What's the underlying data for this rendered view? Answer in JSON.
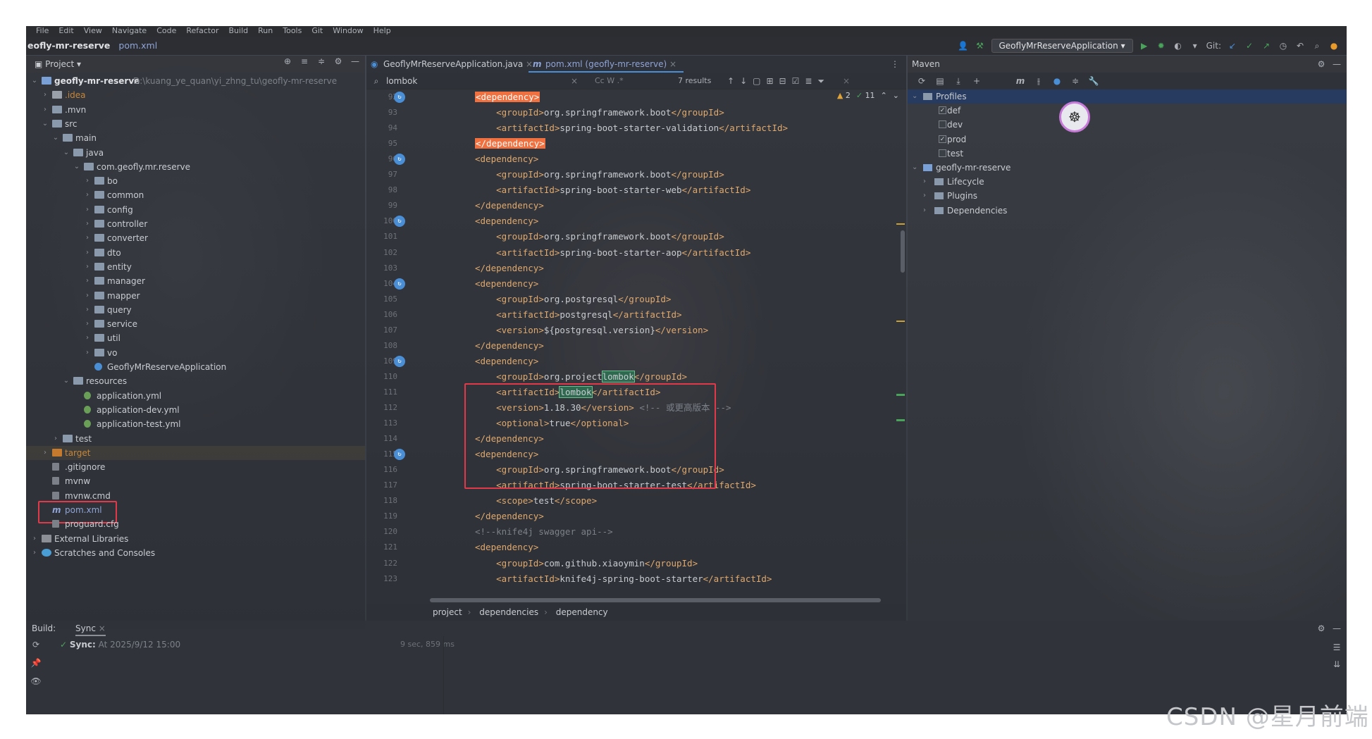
{
  "menu": [
    "File",
    "Edit",
    "View",
    "Navigate",
    "Code",
    "Refactor",
    "Build",
    "Run",
    "Tools",
    "Git",
    "Window",
    "Help"
  ],
  "title": {
    "project": "eofly-mr-reserve",
    "file": "pom.xml"
  },
  "toolbar": {
    "run_config": "GeoflyMrReserveApplication",
    "git_label": "Git:"
  },
  "project_panel": {
    "label": "Project",
    "root_name": "geofly-mr-reserve",
    "root_path": "D:\\kuang_ye_quan\\yi_zhng_tu\\geofly-mr-reserve"
  },
  "tree": [
    {
      "label": "geofly-mr-reserve",
      "depth": 0,
      "type": "module",
      "open": true
    },
    {
      "label": ".idea",
      "depth": 1,
      "type": "folder-orange",
      "open": false
    },
    {
      "label": ".mvn",
      "depth": 1,
      "type": "folder",
      "open": false
    },
    {
      "label": "src",
      "depth": 1,
      "type": "folder",
      "open": true
    },
    {
      "label": "main",
      "depth": 2,
      "type": "folder",
      "open": true
    },
    {
      "label": "java",
      "depth": 3,
      "type": "folder",
      "open": true
    },
    {
      "label": "com.geofly.mr.reserve",
      "depth": 4,
      "type": "package",
      "open": true
    },
    {
      "label": "bo",
      "depth": 5,
      "type": "package",
      "open": false
    },
    {
      "label": "common",
      "depth": 5,
      "type": "package",
      "open": false
    },
    {
      "label": "config",
      "depth": 5,
      "type": "package",
      "open": false
    },
    {
      "label": "controller",
      "depth": 5,
      "type": "package",
      "open": false
    },
    {
      "label": "converter",
      "depth": 5,
      "type": "package",
      "open": false
    },
    {
      "label": "dto",
      "depth": 5,
      "type": "package",
      "open": false
    },
    {
      "label": "entity",
      "depth": 5,
      "type": "package",
      "open": false
    },
    {
      "label": "manager",
      "depth": 5,
      "type": "package",
      "open": false
    },
    {
      "label": "mapper",
      "depth": 5,
      "type": "package",
      "open": false
    },
    {
      "label": "query",
      "depth": 5,
      "type": "package",
      "open": false
    },
    {
      "label": "service",
      "depth": 5,
      "type": "package",
      "open": false
    },
    {
      "label": "util",
      "depth": 5,
      "type": "package",
      "open": false
    },
    {
      "label": "vo",
      "depth": 5,
      "type": "package",
      "open": false
    },
    {
      "label": "GeoflyMrReserveApplication",
      "depth": 5,
      "type": "class"
    },
    {
      "label": "resources",
      "depth": 3,
      "type": "folder",
      "open": true
    },
    {
      "label": "application.yml",
      "depth": 4,
      "type": "yml"
    },
    {
      "label": "application-dev.yml",
      "depth": 4,
      "type": "yml"
    },
    {
      "label": "application-test.yml",
      "depth": 4,
      "type": "yml"
    },
    {
      "label": "test",
      "depth": 2,
      "type": "folder",
      "open": false
    },
    {
      "label": "target",
      "depth": 1,
      "type": "folder-target",
      "open": false
    },
    {
      "label": ".gitignore",
      "depth": 1,
      "type": "file"
    },
    {
      "label": "mvnw",
      "depth": 1,
      "type": "file"
    },
    {
      "label": "mvnw.cmd",
      "depth": 1,
      "type": "file"
    },
    {
      "label": "pom.xml",
      "depth": 1,
      "type": "maven"
    },
    {
      "label": "proguard.cfg",
      "depth": 1,
      "type": "file"
    },
    {
      "label": "External Libraries",
      "depth": 0,
      "type": "lib",
      "open": false
    },
    {
      "label": "Scratches and Consoles",
      "depth": 0,
      "type": "scratch",
      "open": false
    }
  ],
  "editor_tabs": [
    {
      "label": "GeoflyMrReserveApplication.java",
      "active": false
    },
    {
      "label": "pom.xml (geofly-mr-reserve)",
      "active": true
    }
  ],
  "find": {
    "query": "lombok",
    "options": "Cc  W  .*",
    "results": "7 results"
  },
  "inspections": {
    "warnings": "2",
    "ok": "11"
  },
  "code_lines": [
    {
      "n": "92",
      "pre": "",
      "parts": [
        [
          "hl",
          "<dependency>"
        ]
      ]
    },
    {
      "n": "93",
      "pre": "    ",
      "parts": [
        [
          "t",
          "<groupId>"
        ],
        [
          "x",
          "org.springframework.boot"
        ],
        [
          "t",
          "</groupId>"
        ]
      ]
    },
    {
      "n": "94",
      "pre": "    ",
      "parts": [
        [
          "t",
          "<artifactId>"
        ],
        [
          "x",
          "spring-boot-starter-validation"
        ],
        [
          "t",
          "</artifactId>"
        ]
      ]
    },
    {
      "n": "95",
      "pre": "",
      "parts": [
        [
          "hl",
          "</dependency>"
        ]
      ]
    },
    {
      "n": "96",
      "pre": "",
      "parts": [
        [
          "t",
          "<dependency>"
        ]
      ]
    },
    {
      "n": "97",
      "pre": "    ",
      "parts": [
        [
          "t",
          "<groupId>"
        ],
        [
          "x",
          "org.springframework.boot"
        ],
        [
          "t",
          "</groupId>"
        ]
      ]
    },
    {
      "n": "98",
      "pre": "    ",
      "parts": [
        [
          "t",
          "<artifactId>"
        ],
        [
          "x",
          "spring-boot-starter-web"
        ],
        [
          "t",
          "</artifactId>"
        ]
      ]
    },
    {
      "n": "99",
      "pre": "",
      "parts": [
        [
          "t",
          "</dependency>"
        ]
      ]
    },
    {
      "n": "100",
      "pre": "",
      "parts": [
        [
          "t",
          "<dependency>"
        ]
      ]
    },
    {
      "n": "101",
      "pre": "    ",
      "parts": [
        [
          "t",
          "<groupId>"
        ],
        [
          "x",
          "org.springframework.boot"
        ],
        [
          "t",
          "</groupId>"
        ]
      ]
    },
    {
      "n": "102",
      "pre": "    ",
      "parts": [
        [
          "t",
          "<artifactId>"
        ],
        [
          "x",
          "spring-boot-starter-aop"
        ],
        [
          "t",
          "</artifactId>"
        ]
      ]
    },
    {
      "n": "103",
      "pre": "",
      "parts": [
        [
          "t",
          "</dependency>"
        ]
      ]
    },
    {
      "n": "104",
      "pre": "",
      "parts": [
        [
          "t",
          "<dependency>"
        ]
      ]
    },
    {
      "n": "105",
      "pre": "    ",
      "parts": [
        [
          "t",
          "<groupId>"
        ],
        [
          "x",
          "org.postgresql"
        ],
        [
          "t",
          "</groupId>"
        ]
      ]
    },
    {
      "n": "106",
      "pre": "    ",
      "parts": [
        [
          "t",
          "<artifactId>"
        ],
        [
          "x",
          "postgresql"
        ],
        [
          "t",
          "</artifactId>"
        ]
      ]
    },
    {
      "n": "107",
      "pre": "    ",
      "parts": [
        [
          "t",
          "<version>"
        ],
        [
          "x",
          "${postgresql.version}"
        ],
        [
          "t",
          "</version>"
        ]
      ]
    },
    {
      "n": "108",
      "pre": "",
      "parts": [
        [
          "t",
          "</dependency>"
        ]
      ]
    },
    {
      "n": "109",
      "pre": "",
      "parts": [
        [
          "t",
          "<dependency>"
        ]
      ]
    },
    {
      "n": "110",
      "pre": "    ",
      "parts": [
        [
          "t",
          "<groupId>"
        ],
        [
          "x",
          "org.project"
        ],
        [
          "w",
          "lombok"
        ],
        [
          "t",
          "</groupId>"
        ]
      ]
    },
    {
      "n": "111",
      "pre": "    ",
      "parts": [
        [
          "t",
          "<artifactId>"
        ],
        [
          "w",
          "lombok"
        ],
        [
          "t",
          "</artifactId>"
        ]
      ]
    },
    {
      "n": "112",
      "pre": "    ",
      "parts": [
        [
          "t",
          "<version>"
        ],
        [
          "x",
          "1.18.30"
        ],
        [
          "t",
          "</version>"
        ],
        [
          "c",
          " <!-- 或更高版本 -->"
        ]
      ]
    },
    {
      "n": "113",
      "pre": "    ",
      "parts": [
        [
          "t",
          "<optional>"
        ],
        [
          "x",
          "true"
        ],
        [
          "t",
          "</optional>"
        ]
      ]
    },
    {
      "n": "114",
      "pre": "",
      "parts": [
        [
          "t",
          "</dependency>"
        ]
      ]
    },
    {
      "n": "115",
      "pre": "",
      "parts": [
        [
          "t",
          "<dependency>"
        ]
      ]
    },
    {
      "n": "116",
      "pre": "    ",
      "parts": [
        [
          "t",
          "<groupId>"
        ],
        [
          "x",
          "org.springframework.boot"
        ],
        [
          "t",
          "</groupId>"
        ]
      ]
    },
    {
      "n": "117",
      "pre": "    ",
      "parts": [
        [
          "t",
          "<artifactId>"
        ],
        [
          "x",
          "spring-boot-starter-test"
        ],
        [
          "t",
          "</artifactId>"
        ]
      ]
    },
    {
      "n": "118",
      "pre": "    ",
      "parts": [
        [
          "t",
          "<scope>"
        ],
        [
          "x",
          "test"
        ],
        [
          "t",
          "</scope>"
        ]
      ]
    },
    {
      "n": "119",
      "pre": "",
      "parts": [
        [
          "t",
          "</dependency>"
        ]
      ]
    },
    {
      "n": "120",
      "pre": "",
      "parts": [
        [
          "c",
          "<!--knife4j swagger api-->"
        ]
      ]
    },
    {
      "n": "121",
      "pre": "",
      "parts": [
        [
          "t",
          "<dependency>"
        ]
      ]
    },
    {
      "n": "122",
      "pre": "    ",
      "parts": [
        [
          "t",
          "<groupId>"
        ],
        [
          "x",
          "com.github.xiaoymin"
        ],
        [
          "t",
          "</groupId>"
        ]
      ]
    },
    {
      "n": "123",
      "pre": "    ",
      "parts": [
        [
          "t",
          "<artifactId>"
        ],
        [
          "x",
          "knife4j-spring-boot-starter"
        ],
        [
          "t",
          "</artifactId>"
        ]
      ]
    }
  ],
  "gutter_marks": [
    "92",
    "96",
    "100",
    "104",
    "109",
    "115"
  ],
  "breadcrumb": [
    "project",
    "dependencies",
    "dependency"
  ],
  "maven": {
    "title": "Maven",
    "rows": [
      {
        "label": "Profiles",
        "indent": 0,
        "kind": "folder",
        "open": true,
        "selected": true
      },
      {
        "label": "def",
        "indent": 1,
        "kind": "check",
        "checked": true
      },
      {
        "label": "dev",
        "indent": 1,
        "kind": "check",
        "checked": false
      },
      {
        "label": "prod",
        "indent": 1,
        "kind": "check",
        "checked": true
      },
      {
        "label": "test",
        "indent": 1,
        "kind": "check",
        "checked": false
      },
      {
        "label": "geofly-mr-reserve",
        "indent": 0,
        "kind": "module",
        "open": true
      },
      {
        "label": "Lifecycle",
        "indent": 1,
        "kind": "folder",
        "open": false
      },
      {
        "label": "Plugins",
        "indent": 1,
        "kind": "folder",
        "open": false
      },
      {
        "label": "Dependencies",
        "indent": 1,
        "kind": "folder",
        "open": false
      }
    ]
  },
  "build": {
    "label": "Build:",
    "tab": "Sync",
    "status": "Sync:",
    "timestamp": "At 2025/9/12 15:00",
    "duration": "9 sec, 859 ms"
  },
  "watermark": "CSDN @星月前端",
  "colors": {
    "highlight_tag": "#f0703f",
    "highlight_word": "#2f6a50",
    "annotation": "#e03a4a",
    "accent": "#4a8ed6"
  }
}
